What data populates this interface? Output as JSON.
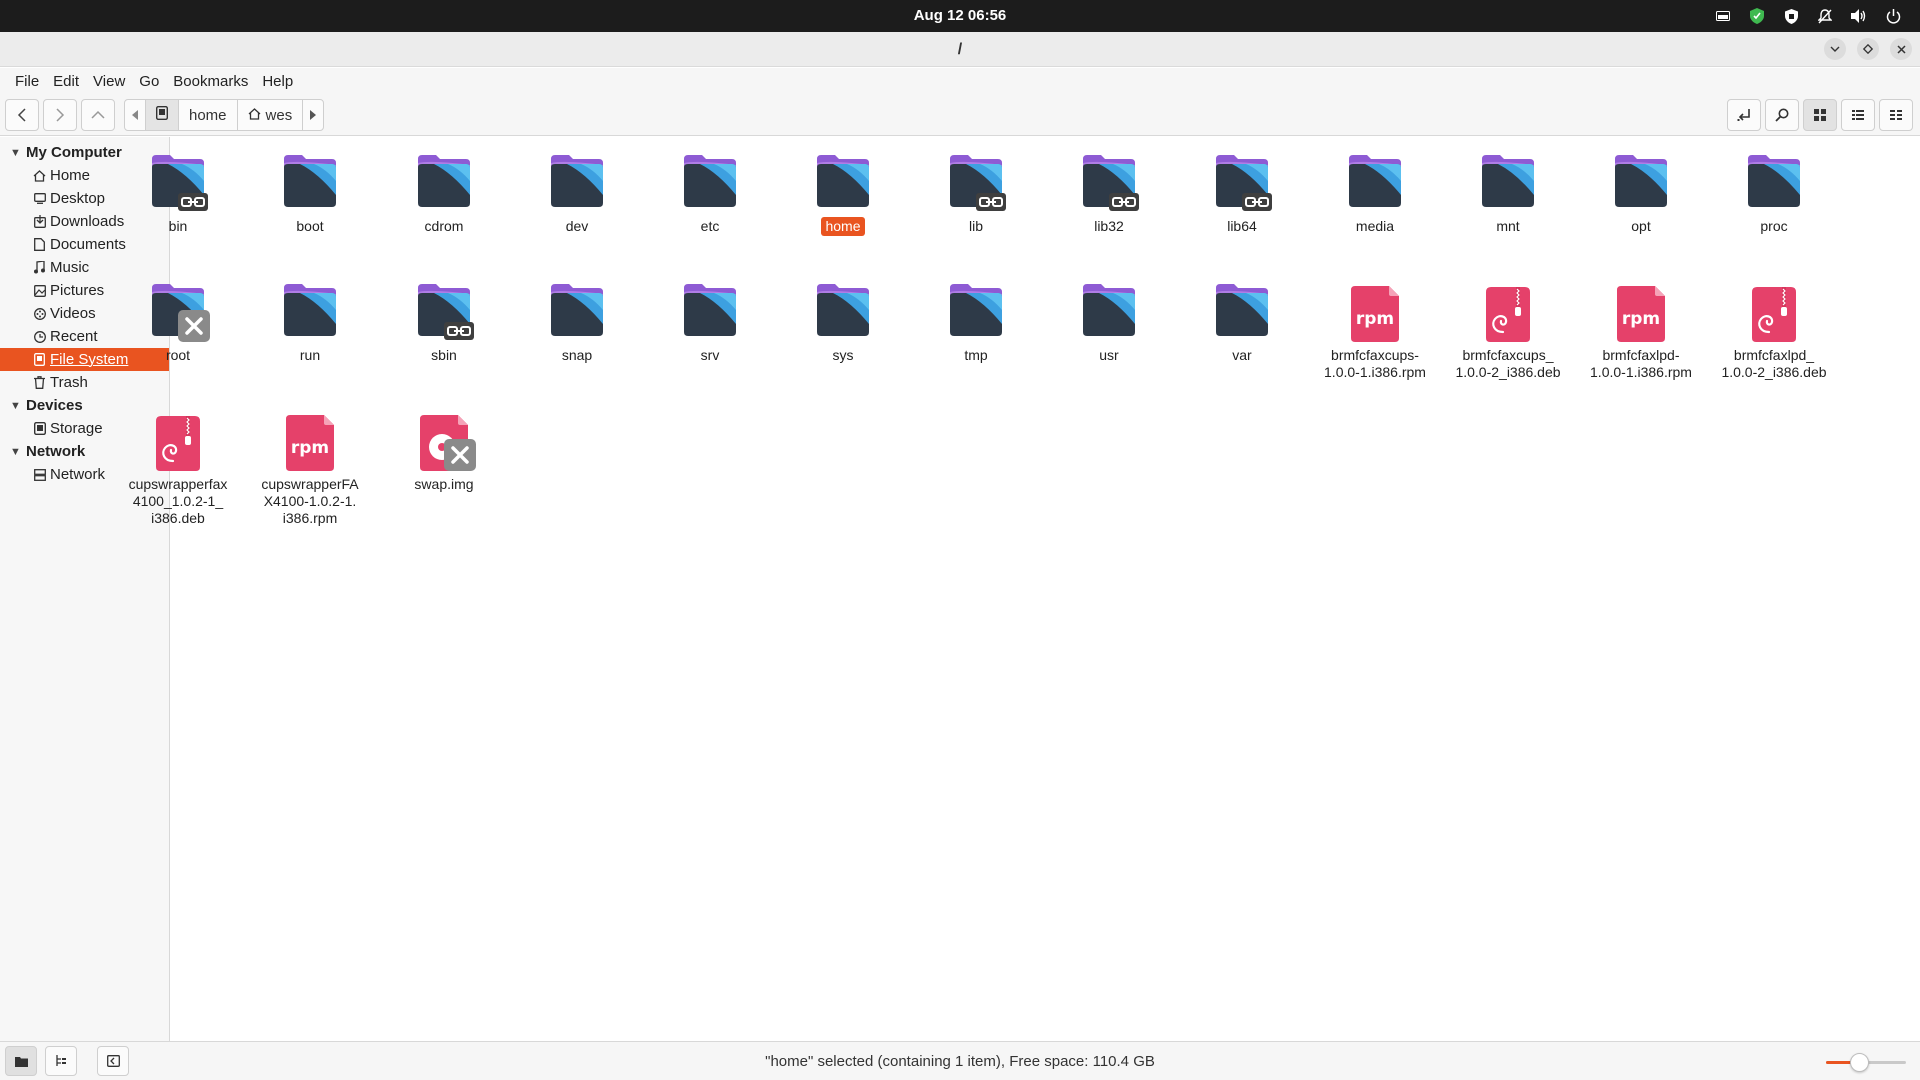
{
  "topbar": {
    "clock": "Aug 12  06:56",
    "tray_icons": [
      "monitor-icon",
      "shield-check-icon",
      "shield-icon",
      "notifications-off-icon",
      "volume-icon",
      "power-icon"
    ]
  },
  "window": {
    "title": "/"
  },
  "menubar": {
    "items": [
      "File",
      "Edit",
      "View",
      "Go",
      "Bookmarks",
      "Help"
    ]
  },
  "toolbar": {
    "breadcrumbs": [
      "home",
      "wes"
    ]
  },
  "sidebar": {
    "sections": [
      {
        "title": "My Computer",
        "items": [
          {
            "label": "Home",
            "icon": "home-icon"
          },
          {
            "label": "Desktop",
            "icon": "desktop-icon"
          },
          {
            "label": "Downloads",
            "icon": "downloads-icon"
          },
          {
            "label": "Documents",
            "icon": "documents-icon"
          },
          {
            "label": "Music",
            "icon": "music-icon"
          },
          {
            "label": "Pictures",
            "icon": "pictures-icon"
          },
          {
            "label": "Videos",
            "icon": "videos-icon"
          },
          {
            "label": "Recent",
            "icon": "recent-icon"
          },
          {
            "label": "File System",
            "icon": "filesystem-icon",
            "selected": true
          },
          {
            "label": "Trash",
            "icon": "trash-icon"
          }
        ]
      },
      {
        "title": "Devices",
        "items": [
          {
            "label": "Storage",
            "icon": "drive-icon"
          }
        ]
      },
      {
        "title": "Network",
        "items": [
          {
            "label": "Network",
            "icon": "network-icon"
          }
        ]
      }
    ]
  },
  "files": [
    {
      "name": "bin",
      "type": "folder",
      "emblem": "link"
    },
    {
      "name": "boot",
      "type": "folder"
    },
    {
      "name": "cdrom",
      "type": "folder"
    },
    {
      "name": "dev",
      "type": "folder"
    },
    {
      "name": "etc",
      "type": "folder"
    },
    {
      "name": "home",
      "type": "folder",
      "selected": true
    },
    {
      "name": "lib",
      "type": "folder",
      "emblem": "link"
    },
    {
      "name": "lib32",
      "type": "folder",
      "emblem": "link"
    },
    {
      "name": "lib64",
      "type": "folder",
      "emblem": "link"
    },
    {
      "name": "media",
      "type": "folder"
    },
    {
      "name": "mnt",
      "type": "folder"
    },
    {
      "name": "opt",
      "type": "folder"
    },
    {
      "name": "proc",
      "type": "folder"
    },
    {
      "name": "root",
      "type": "folder",
      "emblem": "unreadable"
    },
    {
      "name": "run",
      "type": "folder"
    },
    {
      "name": "sbin",
      "type": "folder",
      "emblem": "link"
    },
    {
      "name": "snap",
      "type": "folder"
    },
    {
      "name": "srv",
      "type": "folder"
    },
    {
      "name": "sys",
      "type": "folder"
    },
    {
      "name": "tmp",
      "type": "folder"
    },
    {
      "name": "usr",
      "type": "folder"
    },
    {
      "name": "var",
      "type": "folder"
    },
    {
      "name": "brmfcfaxcups-\n1.0.0-1.i386.rpm",
      "type": "rpm"
    },
    {
      "name": "brmfcfaxcups_\n1.0.0-2_i386.deb",
      "type": "deb"
    },
    {
      "name": "brmfcfaxlpd-\n1.0.0-1.i386.rpm",
      "type": "rpm"
    },
    {
      "name": "brmfcfaxlpd_\n1.0.0-2_i386.deb",
      "type": "deb"
    },
    {
      "name": "cupswrapperfax\n4100_1.0.2-1_\ni386.deb",
      "type": "deb"
    },
    {
      "name": "cupswrapperFA\nX4100-1.0.2-1.\ni386.rpm",
      "type": "rpm"
    },
    {
      "name": "swap.img",
      "type": "disk",
      "emblem": "unreadable"
    }
  ],
  "statusbar": {
    "text": "\"home\" selected (containing 1 item), Free space: 110.4 GB",
    "zoom_level": 0.4
  },
  "colors": {
    "accent": "#e95420",
    "folder_top": "#8e5bd4",
    "folder_front": "#2e3a48",
    "folder_blue": "#3da0e0",
    "package_pink": "#e5416a"
  }
}
